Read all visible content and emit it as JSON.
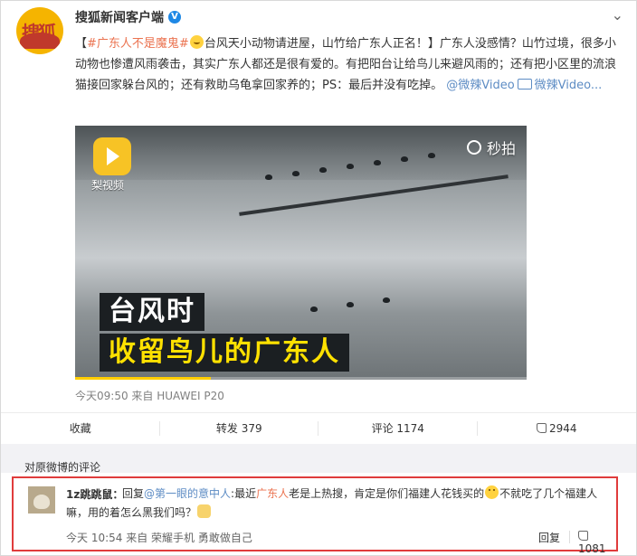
{
  "post": {
    "author": "搜狐新闻客户端",
    "avatar_text": "搜狐",
    "verified_icon": "verified-v-icon",
    "more_icon": "chevron-down-icon",
    "topic": "#广东人不是魔鬼#",
    "text_bracket_open": "【",
    "text_title": "台风天小动物请进屋，山竹给广东人正名！",
    "text_body": "】广东人没感情？山竹过境，很多小动物也惨遭风雨袭击，其实广东人都还是很有爱的。有把阳台让给鸟儿来避风雨的；还有把小区里的流浪猫接回家躲台风的；还有救助乌龟拿回家养的；PS：最后并没有吃掉。",
    "mention": "@微辣Video",
    "video_link": "微辣Video..."
  },
  "video": {
    "source_label": "梨视频",
    "watermark": "秒拍",
    "caption_line1": "台风时",
    "caption_line2": "收留鸟儿的广东人",
    "progress": 0.3
  },
  "meta": {
    "time_source": "今天09:50 来自 HUAWEI P20"
  },
  "actions": {
    "favorite": "收藏",
    "repost": "转发 379",
    "comment": "评论 1174",
    "like": "2944"
  },
  "comments": {
    "title": "对原微博的评论",
    "items": [
      {
        "user": "1z跳跳鼠",
        "colon": "：",
        "reply_prefix": "回复",
        "reply_to": "@第一眼的意中人",
        "text_a": ":最近",
        "keyword": "广东人",
        "text_b": "老是上热搜，肯定是你们福建人花钱买的",
        "text_c": "不就吃了几个福建人嘛，用的着怎么黑我们吗？",
        "meta": "今天 10:54 来自 荣耀手机 勇敢做自己",
        "reply": "回复",
        "likes": "1081"
      }
    ]
  },
  "colors": {
    "accent_link": "#eb7350",
    "blue_link": "#5d8cc4",
    "highlight_border": "#e03c3c"
  }
}
